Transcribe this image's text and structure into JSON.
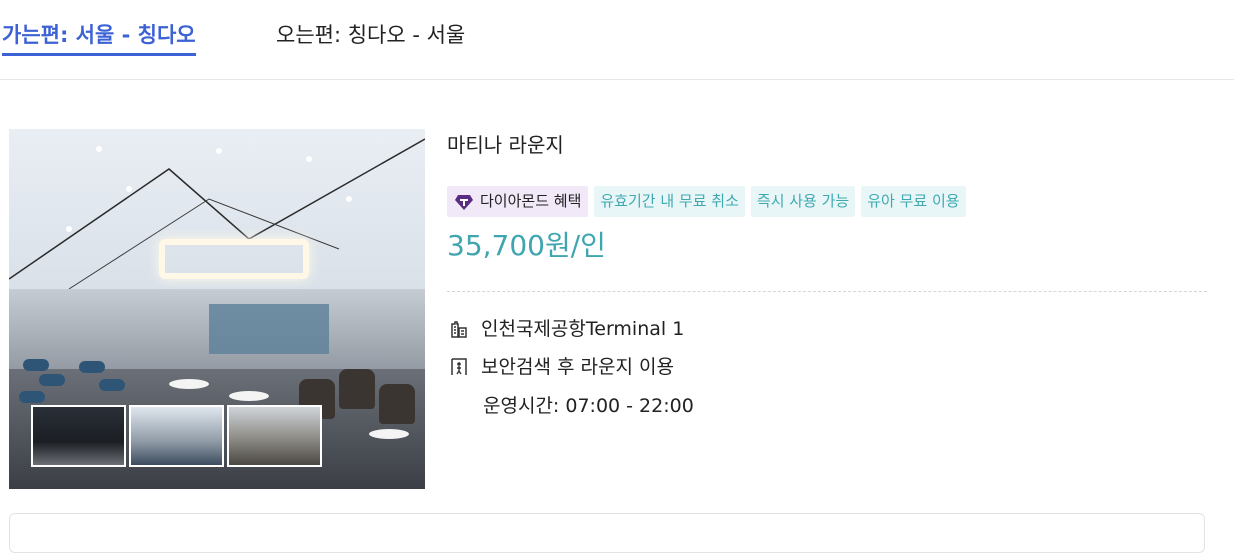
{
  "tabs": [
    {
      "label": "가는편: 서울 - 칭다오",
      "active": true
    },
    {
      "label": "오는편: 칭다오 - 서울",
      "active": false
    }
  ],
  "lounge": {
    "name": "마티나 라운지",
    "tags": [
      {
        "label": "다이아몬드 혜택",
        "icon": "diamond-icon"
      },
      {
        "label": "유효기간 내 무료 취소"
      },
      {
        "label": "즉시 사용 가능"
      },
      {
        "label": "유아 무료 이용"
      }
    ],
    "price": "35,700원/인",
    "info": {
      "location": "인천국제공항Terminal 1",
      "access": "보안검색 후 라운지 이용",
      "hours": "운영시간: 07:00 - 22:00"
    }
  },
  "colors": {
    "accent": "#3d62d6",
    "price": "#3fa6b0",
    "tag_text": "#3fa9b2",
    "tag_bg": "#e8f6f7",
    "diamond_bg": "#f1e9f8",
    "diamond_icon": "#5a2d82"
  }
}
